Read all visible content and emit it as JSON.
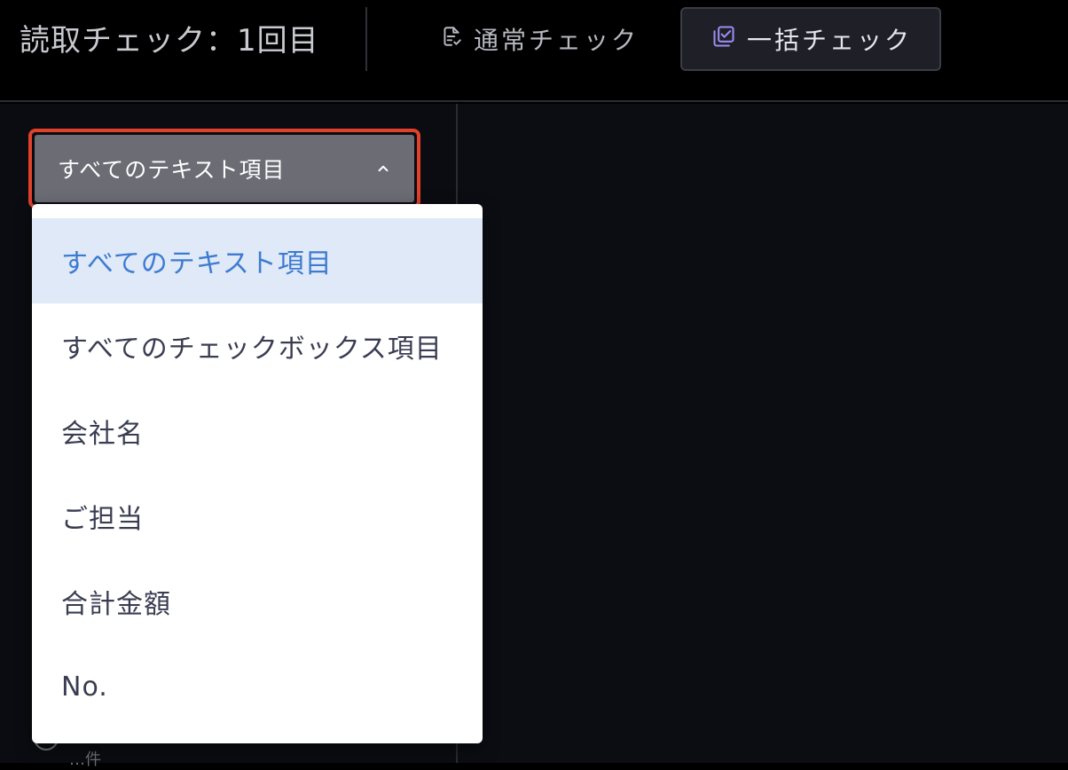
{
  "header": {
    "title": "読取チェック：1回目",
    "tabs": [
      {
        "label": "通常チェック",
        "icon": "document-check-icon",
        "active": false
      },
      {
        "label": "一括チェック",
        "icon": "checkbox-list-icon",
        "active": true
      }
    ]
  },
  "filter_select": {
    "selected_label": "すべてのテキスト項目",
    "expanded": true,
    "options": [
      {
        "label": "すべてのテキスト項目",
        "selected": true
      },
      {
        "label": "すべてのチェックボックス項目",
        "selected": false
      },
      {
        "label": "会社名",
        "selected": false
      },
      {
        "label": "ご担当",
        "selected": false
      },
      {
        "label": "合計金額",
        "selected": false
      },
      {
        "label": "No.",
        "selected": false
      }
    ]
  },
  "partial_hidden": {
    "count_text": "…件"
  },
  "colors": {
    "accent_blue": "#3e7bd0",
    "selected_bg": "#dfe9f7",
    "focus_outline": "#e0412b",
    "active_icon": "#9b8cf0"
  }
}
